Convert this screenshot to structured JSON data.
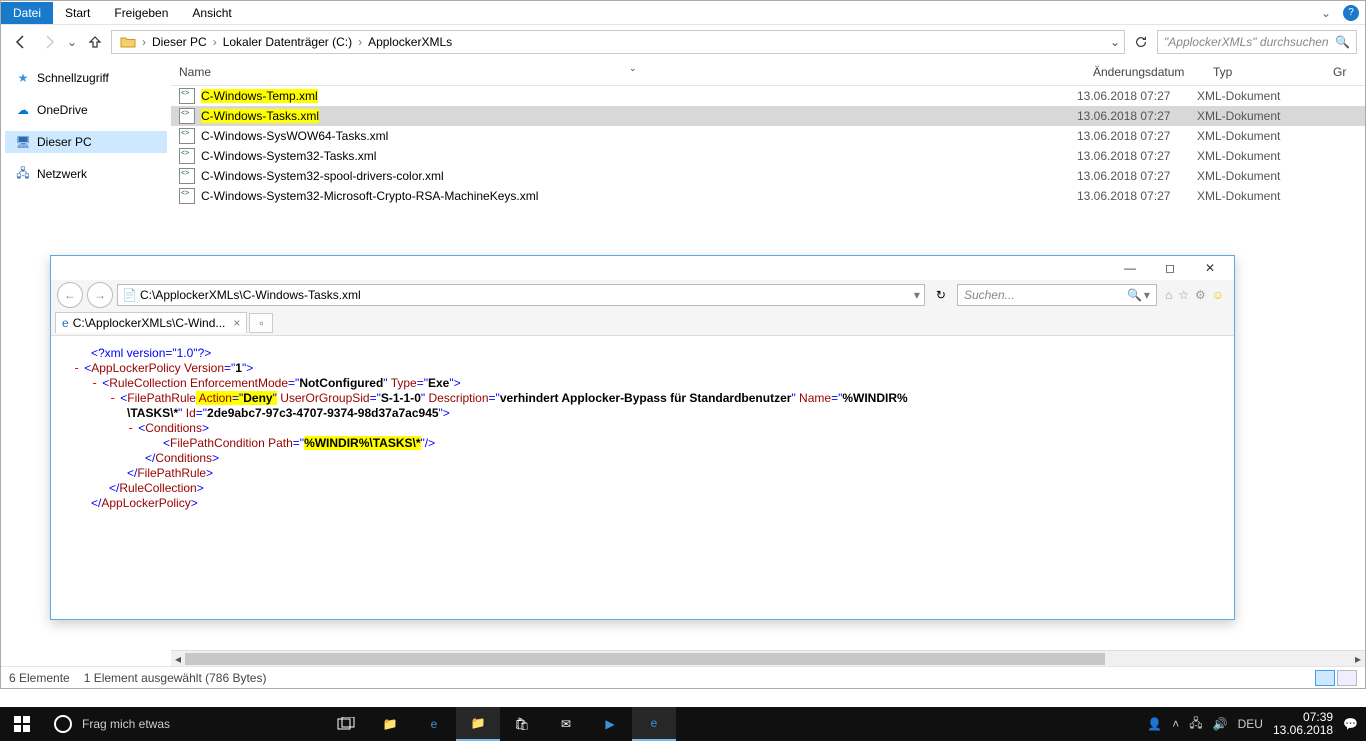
{
  "explorer": {
    "ribbon": {
      "file": "Datei",
      "start": "Start",
      "share": "Freigeben",
      "view": "Ansicht"
    },
    "breadcrumbs": [
      "Dieser PC",
      "Lokaler Datenträger (C:)",
      "ApplockerXMLs"
    ],
    "search_placeholder": "\"ApplockerXMLs\" durchsuchen",
    "columns": {
      "name": "Name",
      "date": "Änderungsdatum",
      "type": "Typ",
      "size": "Gr"
    },
    "sidebar": {
      "quick": "Schnellzugriff",
      "onedrive": "OneDrive",
      "thispc": "Dieser PC",
      "network": "Netzwerk"
    },
    "files": [
      {
        "name": "C-Windows-Temp.xml",
        "date": "13.06.2018 07:27",
        "type": "XML-Dokument",
        "highlight": true,
        "selected": false
      },
      {
        "name": "C-Windows-Tasks.xml",
        "date": "13.06.2018 07:27",
        "type": "XML-Dokument",
        "highlight": true,
        "selected": true
      },
      {
        "name": "C-Windows-SysWOW64-Tasks.xml",
        "date": "13.06.2018 07:27",
        "type": "XML-Dokument",
        "highlight": false,
        "selected": false
      },
      {
        "name": "C-Windows-System32-Tasks.xml",
        "date": "13.06.2018 07:27",
        "type": "XML-Dokument",
        "highlight": false,
        "selected": false
      },
      {
        "name": "C-Windows-System32-spool-drivers-color.xml",
        "date": "13.06.2018 07:27",
        "type": "XML-Dokument",
        "highlight": false,
        "selected": false
      },
      {
        "name": "C-Windows-System32-Microsoft-Crypto-RSA-MachineKeys.xml",
        "date": "13.06.2018 07:27",
        "type": "XML-Dokument",
        "highlight": false,
        "selected": false
      }
    ],
    "status": {
      "count": "6 Elemente",
      "selection": "1 Element ausgewählt (786 Bytes)"
    }
  },
  "ie": {
    "address": "C:\\ApplockerXMLs\\C-Windows-Tasks.xml",
    "search_placeholder": "Suchen...",
    "tab_title": "C:\\ApplockerXMLs\\C-Wind...",
    "xml": {
      "decl": "<?xml version=\"1.0\"?>",
      "policy_open": "AppLockerPolicy",
      "version_label": "Version",
      "version_val": "1",
      "rulecol": "RuleCollection",
      "enf_label": "EnforcementMode",
      "enf_val": "NotConfigured",
      "type_label": "Type",
      "type_val": "Exe",
      "fpr": "FilePathRule",
      "action_label": "Action",
      "action_val": "Deny",
      "sid_label": "UserOrGroupSid",
      "sid_val": "S-1-1-0",
      "desc_label": "Description",
      "desc_val": "verhindert Applocker-Bypass für Standardbenutzer",
      "name_label": "Name",
      "name_val1": "%WINDIR%",
      "name_val2": "\\TASKS\\*",
      "id_label": "Id",
      "id_val": "2de9abc7-97c3-4707-9374-98d37a7ac945",
      "cond": "Conditions",
      "fpc": "FilePathCondition",
      "path_label": "Path",
      "path_val": "%WINDIR%\\TASKS\\*"
    }
  },
  "taskbar": {
    "search_placeholder": "Frag mich etwas",
    "lang": "DEU",
    "time": "07:39",
    "date": "13.06.2018"
  }
}
